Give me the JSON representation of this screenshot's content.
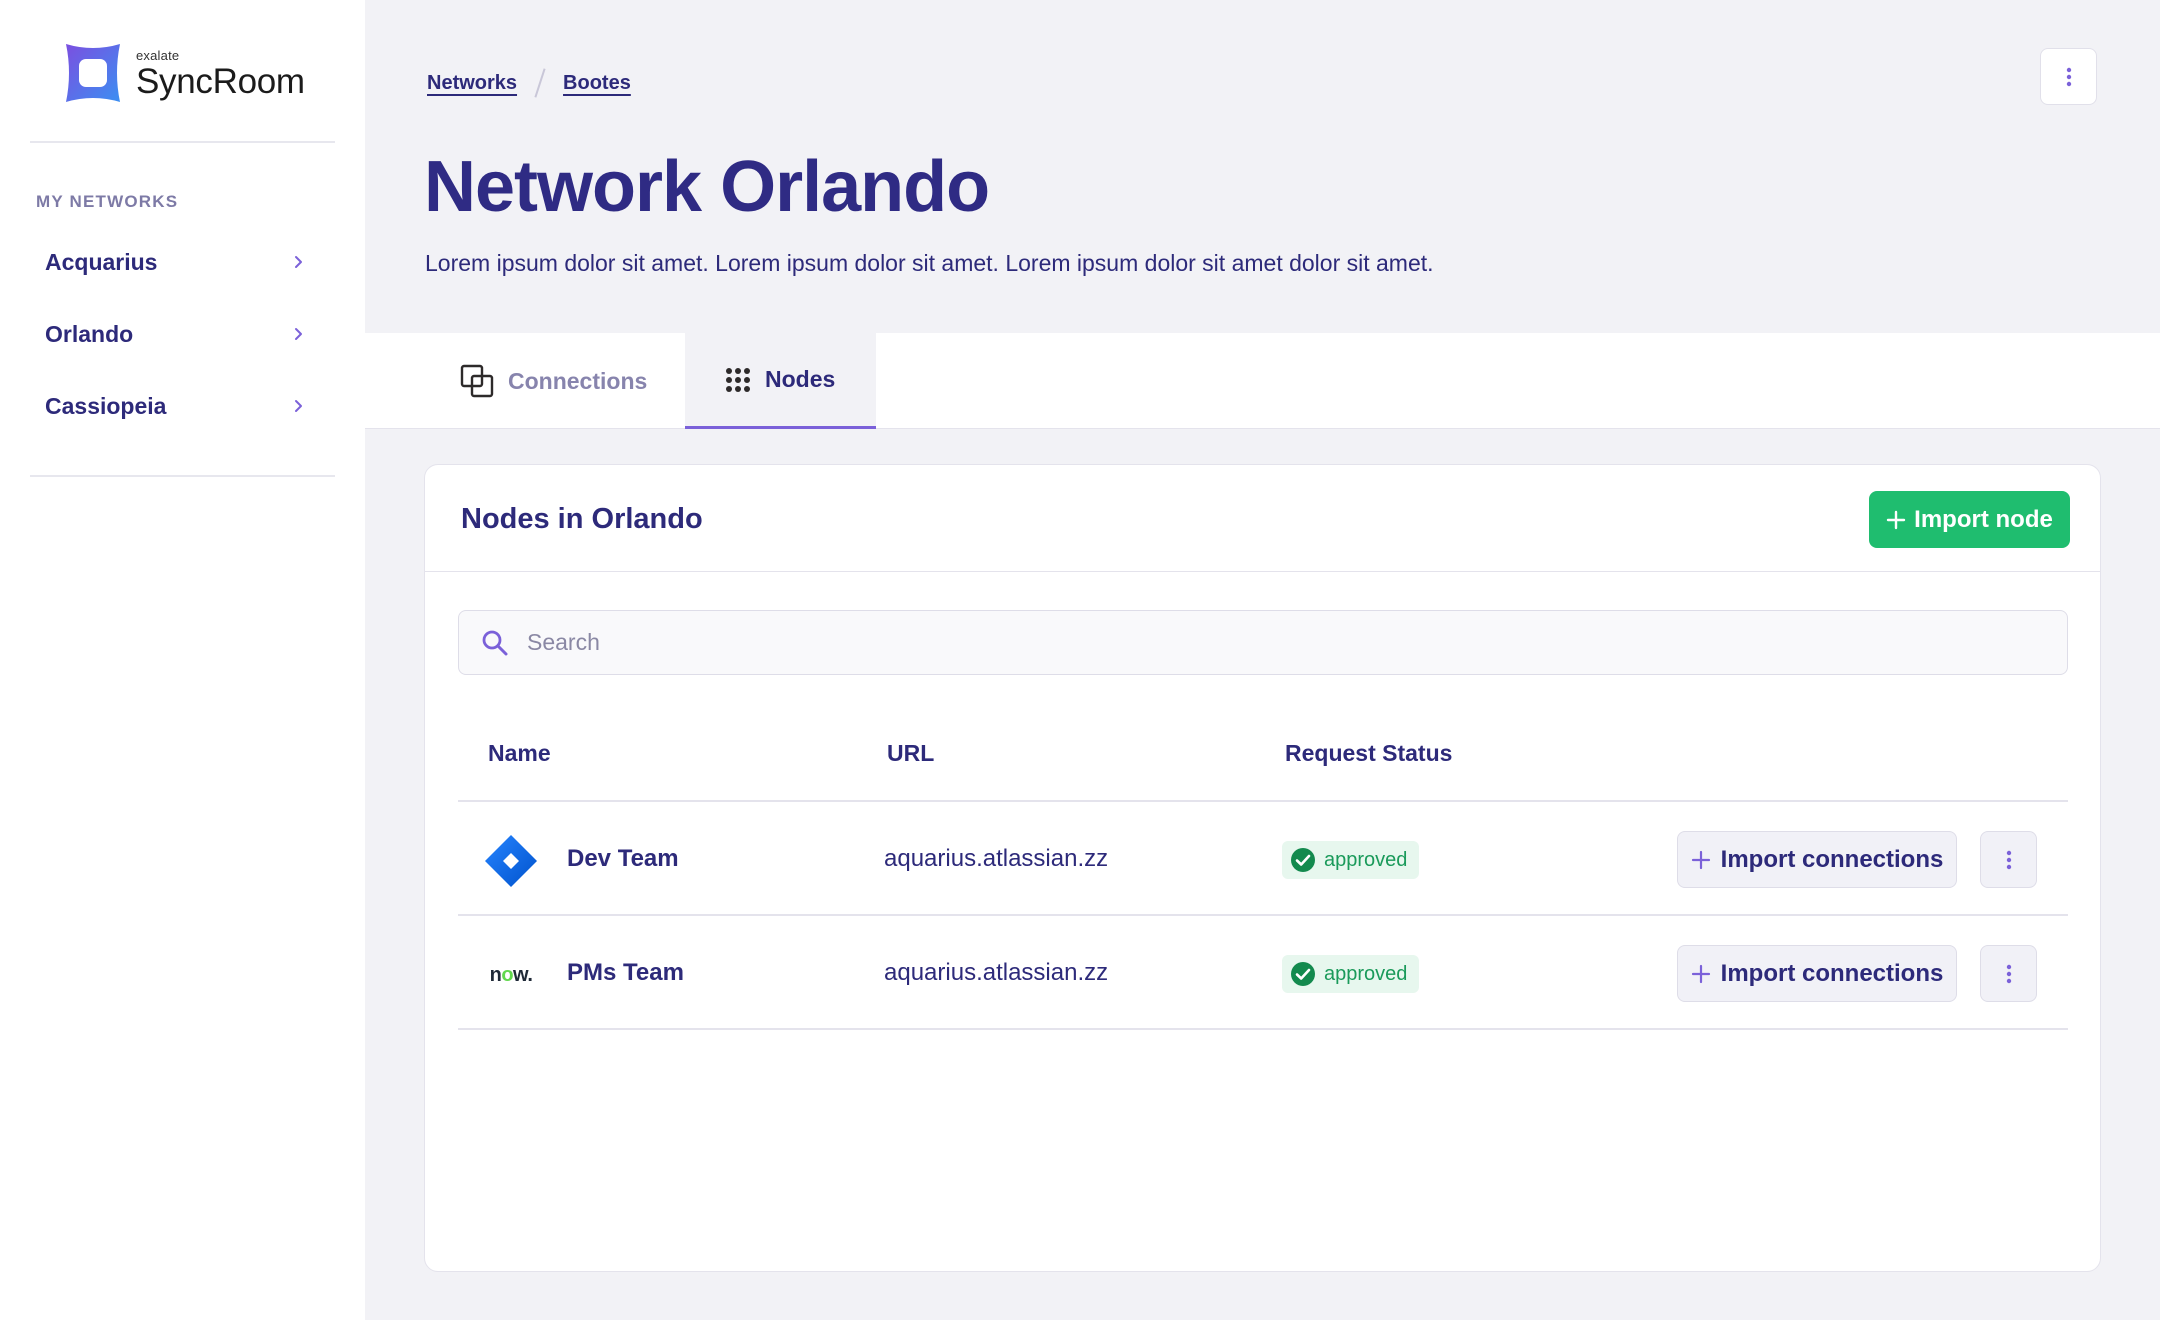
{
  "brand": {
    "small_text": "exalate",
    "name": "SyncRoom",
    "colors": {
      "logo_start": "#6a4de0",
      "logo_end": "#3f8cf0"
    }
  },
  "sidebar": {
    "heading": "MY NETWORKS",
    "items": [
      {
        "label": "Acquarius"
      },
      {
        "label": "Orlando"
      },
      {
        "label": "Cassiopeia"
      }
    ]
  },
  "breadcrumb": [
    "Networks",
    "Bootes"
  ],
  "header": {
    "title": "Network Orlando",
    "description": "Lorem ipsum dolor sit amet. Lorem ipsum dolor sit amet. Lorem ipsum dolor sit amet dolor sit amet."
  },
  "tabs": [
    {
      "label": "Connections",
      "icon": "connections-icon",
      "active": false
    },
    {
      "label": "Nodes",
      "icon": "grid-dots-icon",
      "active": true
    }
  ],
  "card": {
    "title": "Nodes in Orlando",
    "import_button": "Import node",
    "search_placeholder": "Search",
    "columns": [
      "Name",
      "URL",
      "Request Status"
    ],
    "rows": [
      {
        "name": "Dev Team",
        "logo": "jira-logo",
        "url": "aquarius.atlassian.zz",
        "status": "approved",
        "action": "Import connections"
      },
      {
        "name": "PMs Team",
        "logo": "servicenow-logo",
        "url": "aquarius.atlassian.zz",
        "status": "approved",
        "action": "Import connections"
      }
    ],
    "logo_text_now": [
      "n",
      "o",
      "w."
    ]
  },
  "colors": {
    "accent": "#2d2a7a",
    "primary_button": "#1fbd6f",
    "tab_indicator": "#7b61d9",
    "status_approved": "#1a9a5a"
  }
}
